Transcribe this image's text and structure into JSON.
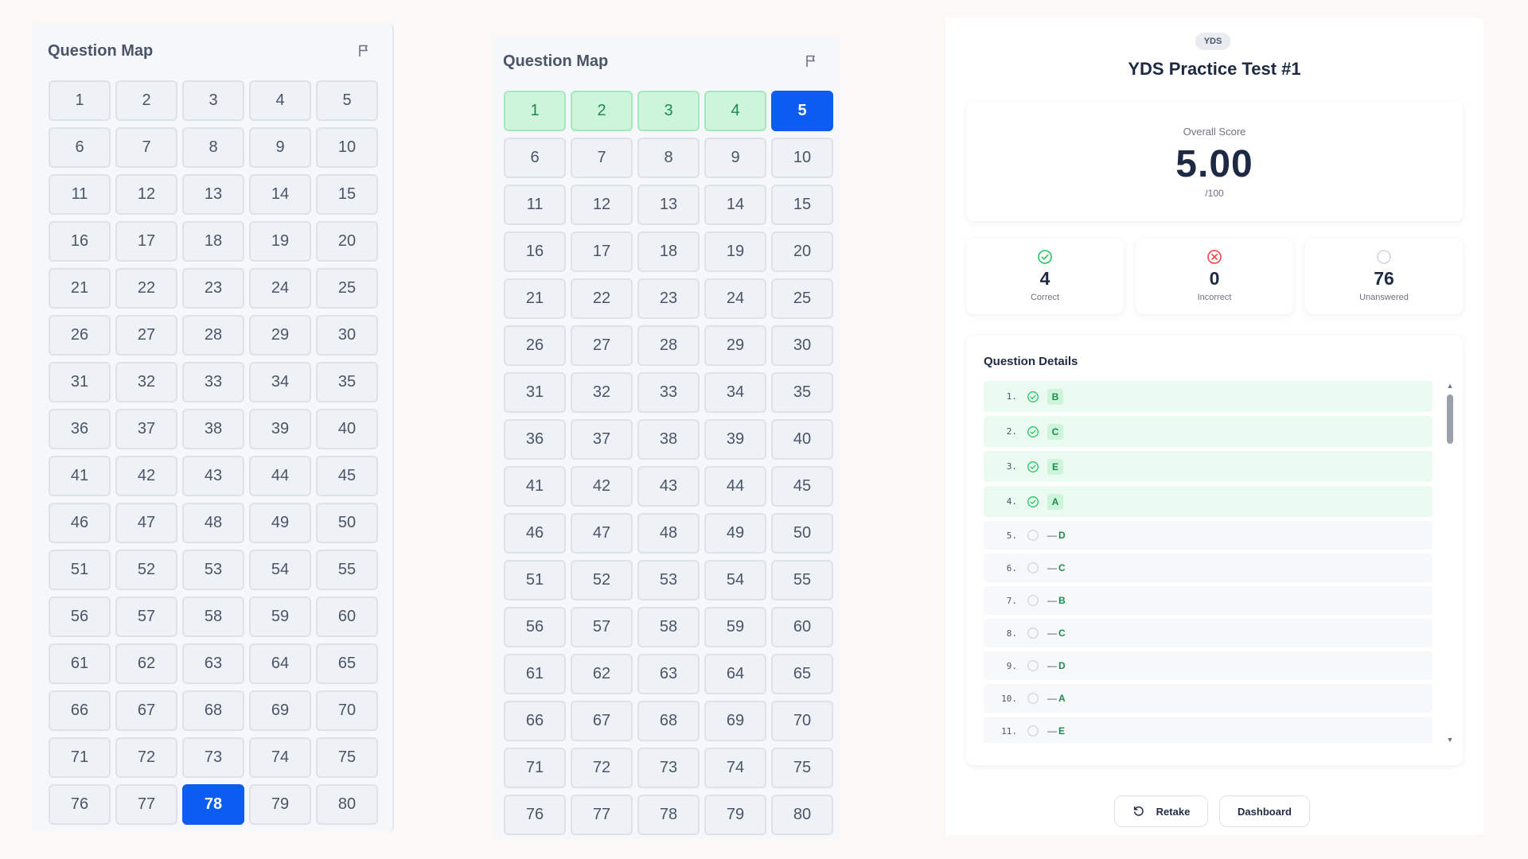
{
  "question_map_left": {
    "title": "Question Map",
    "icon": "flag-icon",
    "current": 78,
    "answered": []
  },
  "question_map_right": {
    "title": "Question Map",
    "icon": "flag-icon",
    "current": 5,
    "answered": [
      1,
      2,
      3,
      4
    ]
  },
  "questions": [
    "1",
    "2",
    "3",
    "4",
    "5",
    "6",
    "7",
    "8",
    "9",
    "10",
    "11",
    "12",
    "13",
    "14",
    "15",
    "16",
    "17",
    "18",
    "19",
    "20",
    "21",
    "22",
    "23",
    "24",
    "25",
    "26",
    "27",
    "28",
    "29",
    "30",
    "31",
    "32",
    "33",
    "34",
    "35",
    "36",
    "37",
    "38",
    "39",
    "40",
    "41",
    "42",
    "43",
    "44",
    "45",
    "46",
    "47",
    "48",
    "49",
    "50",
    "51",
    "52",
    "53",
    "54",
    "55",
    "56",
    "57",
    "58",
    "59",
    "60",
    "61",
    "62",
    "63",
    "64",
    "65",
    "66",
    "67",
    "68",
    "69",
    "70",
    "71",
    "72",
    "73",
    "74",
    "75",
    "76",
    "77",
    "78",
    "79",
    "80"
  ],
  "results": {
    "badge": "YDS",
    "title": "YDS Practice Test #1",
    "score_label": "Overall Score",
    "score_value": "5.00",
    "score_unit": "/100",
    "stats": {
      "correct": {
        "value": "4",
        "label": "Correct",
        "icon": "check-circle-icon",
        "color": "#22c55e"
      },
      "incorrect": {
        "value": "0",
        "label": "Incorrect",
        "icon": "x-circle-icon",
        "color": "#ef4444"
      },
      "unanswered": {
        "value": "76",
        "label": "Unanswered",
        "icon": "empty-circle-icon",
        "color": "#d1d5db"
      }
    },
    "details_title": "Question Details",
    "details": [
      {
        "num": "1.",
        "status": "correct",
        "answer": "B"
      },
      {
        "num": "2.",
        "status": "correct",
        "answer": "C"
      },
      {
        "num": "3.",
        "status": "correct",
        "answer": "E"
      },
      {
        "num": "4.",
        "status": "correct",
        "answer": "A"
      },
      {
        "num": "5.",
        "status": "unanswered",
        "user": "—",
        "correct": "D"
      },
      {
        "num": "6.",
        "status": "unanswered",
        "user": "—",
        "correct": "C"
      },
      {
        "num": "7.",
        "status": "unanswered",
        "user": "—",
        "correct": "B"
      },
      {
        "num": "8.",
        "status": "unanswered",
        "user": "—",
        "correct": "C"
      },
      {
        "num": "9.",
        "status": "unanswered",
        "user": "—",
        "correct": "D"
      },
      {
        "num": "10.",
        "status": "unanswered",
        "user": "—",
        "correct": "A"
      },
      {
        "num": "11.",
        "status": "unanswered",
        "user": "—",
        "correct": "E"
      }
    ],
    "retake_label": "Retake",
    "dashboard_label": "Dashboard"
  },
  "colors": {
    "accent": "#0b5cf0",
    "answered_bg": "#cdf5dc",
    "answered_text": "#1f8a4c"
  }
}
